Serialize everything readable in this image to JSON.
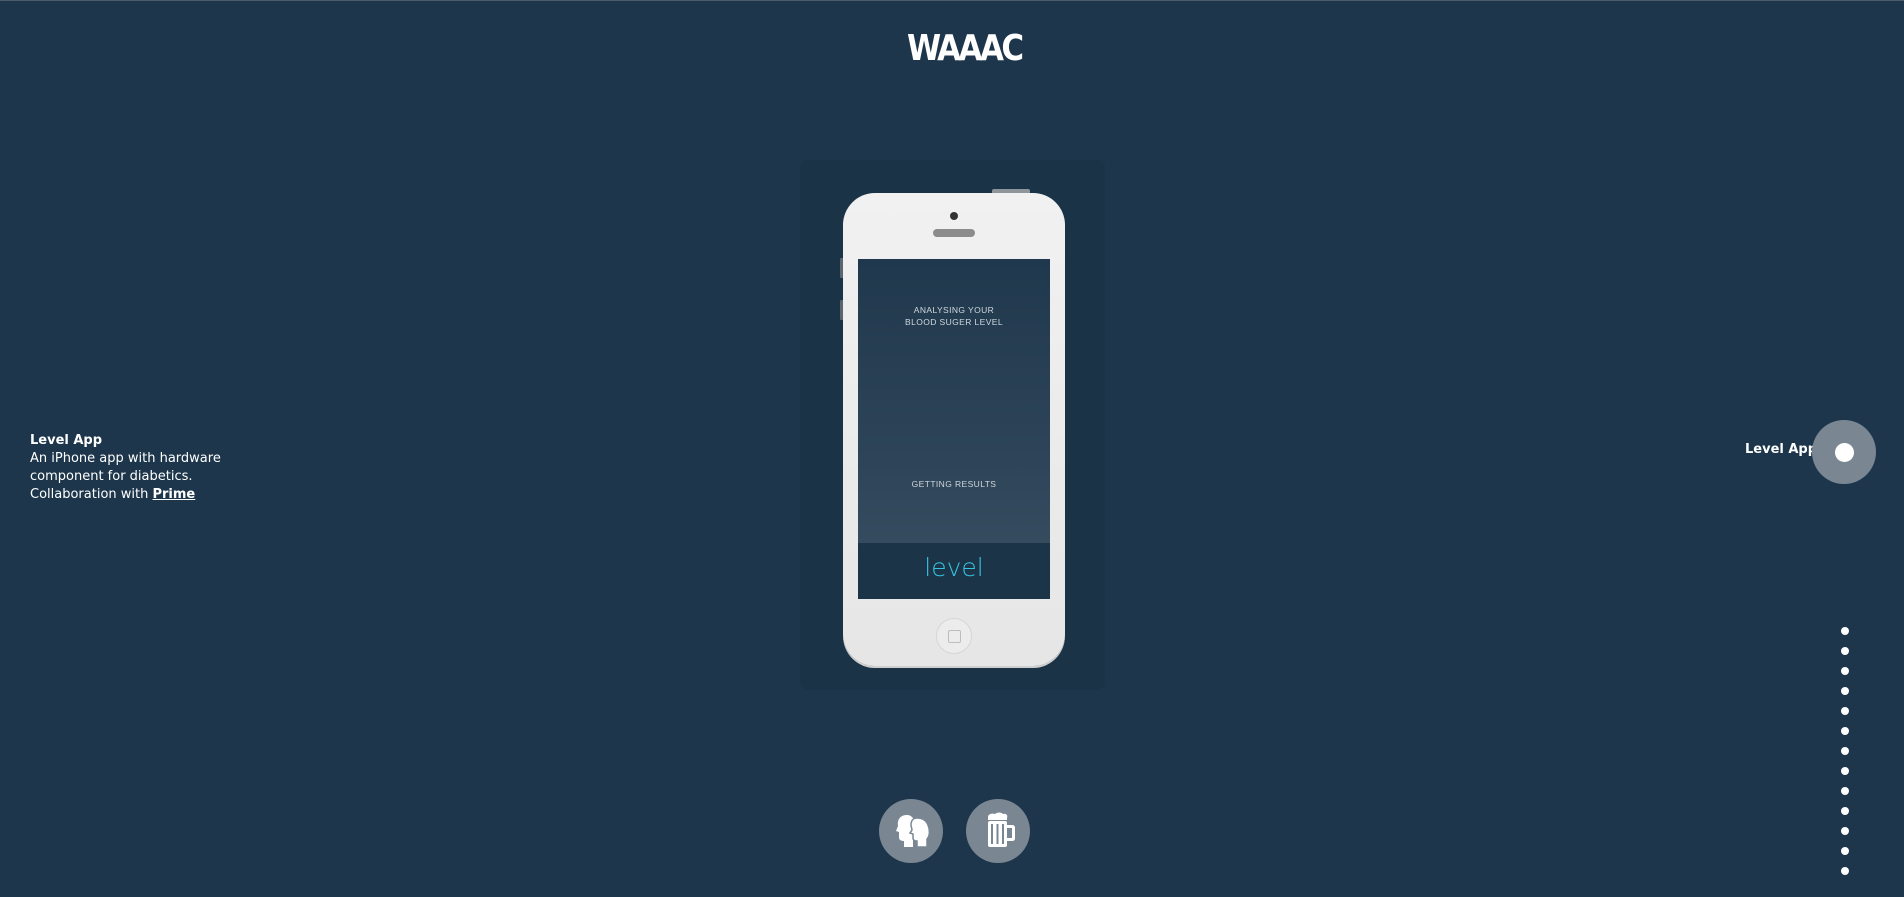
{
  "header": {
    "logo_text": "WAAAC"
  },
  "project": {
    "title": "Level App",
    "line1": "An iPhone app with hardware",
    "line2": "component for diabetics.",
    "collab_prefix": "Collaboration with ",
    "collab_link": "Prime"
  },
  "phone_screen": {
    "analysing_line1": "ANALYSING YOUR",
    "analysing_line2": "BLOOD SUGER LEVEL",
    "getting_results": "GETTING RESULTS",
    "brand_word": "level"
  },
  "right_panel": {
    "label": "Level App"
  },
  "pager": {
    "count": 13
  },
  "bottom_buttons": [
    {
      "icon": "faces-icon"
    },
    {
      "icon": "beer-mug-icon"
    }
  ],
  "colors": {
    "background": "#1d364b",
    "button_fill": "#7a8793",
    "accent_cyan": "#36c3e0"
  }
}
